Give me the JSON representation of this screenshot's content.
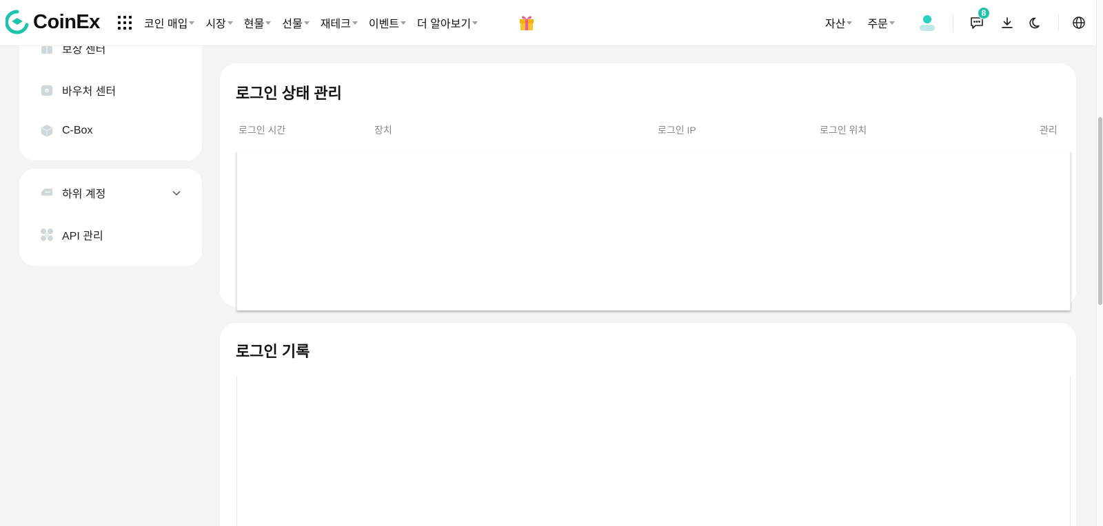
{
  "header": {
    "brand": "CoinEx",
    "nav": [
      "코인 매입",
      "시장",
      "현물",
      "선물",
      "재테크",
      "이벤트",
      "더 알아보기"
    ],
    "right_nav": [
      "자산",
      "주문"
    ],
    "message_count": "8",
    "icons": [
      "apps-grid-icon",
      "gift-icon",
      "avatar-icon",
      "message-icon",
      "download-icon",
      "moon-icon",
      "globe-icon"
    ],
    "accent_color": "#1dc4ab"
  },
  "sidebar": {
    "group1": [
      "보상 센터",
      "바우처 센터",
      "C-Box"
    ],
    "group2": [
      "하위 계정",
      "API 관리"
    ]
  },
  "login_status": {
    "title": "로그인 상태 관리",
    "columns": [
      "로그인 시간",
      "장치",
      "로그인 IP",
      "로그인 위치",
      "관리"
    ]
  },
  "login_history": {
    "title": "로그인 기록"
  }
}
